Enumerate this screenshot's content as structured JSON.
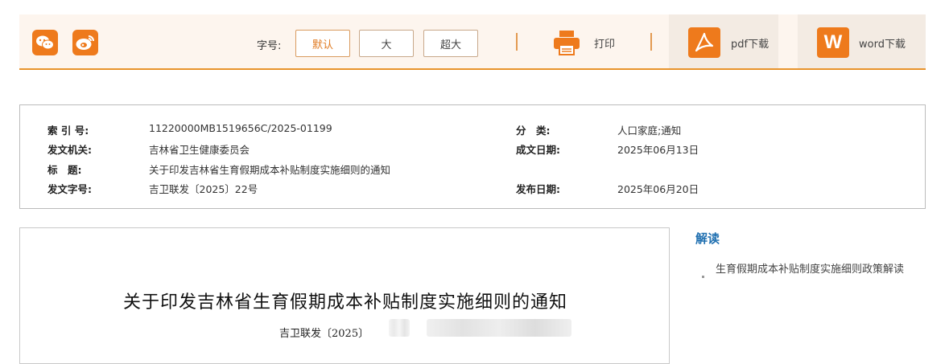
{
  "toolbar": {
    "share_icons": [
      "wechat-icon",
      "weibo-icon"
    ],
    "font_size_label": "字号:",
    "font_size_options": [
      "默认",
      "大",
      "超大"
    ],
    "active_font_size": "默认",
    "print_label": "打印",
    "pdf_label": "pdf下载",
    "word_label": "word下载",
    "word_icon_letter": "W",
    "accent_color": "#ee7a1c"
  },
  "meta": {
    "index_key": "索 引 号:",
    "index_val": "11220000MB1519656C/2025-01199",
    "category_key": "分　类:",
    "category_val": "人口家庭;通知",
    "issuer_key": "发文机关:",
    "issuer_val": "吉林省卫生健康委员会",
    "created_key": "成文日期:",
    "created_val": "2025年06月13日",
    "title_key": "标　题:",
    "title_val": "关于印发吉林省生育假期成本补贴制度实施细则的通知",
    "docno_key": "发文字号:",
    "docno_val": "吉卫联发〔2025〕22号",
    "published_key": "发布日期:",
    "published_val": "2025年06月20日"
  },
  "document": {
    "title": "关于印发吉林省生育假期成本补贴制度实施细则的通知",
    "number_prefix": "吉卫联发〔2025〕"
  },
  "sidebar": {
    "title": "解读",
    "link": "生育假期成本补贴制度实施细则政策解读"
  }
}
